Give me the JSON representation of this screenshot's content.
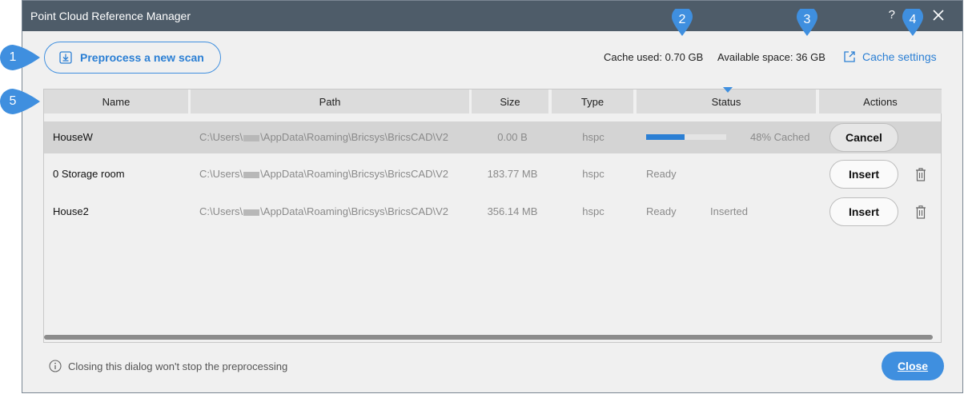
{
  "window": {
    "title": "Point Cloud Reference Manager",
    "help": "?"
  },
  "toolbar": {
    "preprocess_label": "Preprocess a new scan",
    "cache_used": "Cache used: 0.70 GB",
    "available_space": "Available space: 36 GB",
    "cache_settings_label": "Cache settings"
  },
  "table": {
    "columns": [
      "Name",
      "Path",
      "Size",
      "Type",
      "Status",
      "Actions"
    ],
    "rows": [
      {
        "name": "HouseW",
        "path_prefix": "C:\\Users\\",
        "path_suffix": "\\AppData\\Roaming\\Bricsys\\BricsCAD\\V2",
        "size": "0.00 B",
        "type": "hspc",
        "progress": 0.48,
        "progress_label": "48% Cached",
        "action": "Cancel"
      },
      {
        "name": "0 Storage room",
        "path_prefix": "C:\\Users\\",
        "path_suffix": "\\AppData\\Roaming\\Bricsys\\BricsCAD\\V2",
        "size": "183.77 MB",
        "type": "hspc",
        "status": "Ready",
        "action": "Insert"
      },
      {
        "name": "House2",
        "path_prefix": "C:\\Users\\",
        "path_suffix": "\\AppData\\Roaming\\Bricsys\\BricsCAD\\V2",
        "size": "356.14 MB",
        "type": "hspc",
        "status": "Ready",
        "status_extra": "Inserted",
        "action": "Insert"
      }
    ]
  },
  "footer": {
    "note": "Closing this dialog won't stop the preprocessing",
    "close_label": "Close"
  },
  "callouts": [
    "1",
    "2",
    "3",
    "4",
    "5"
  ],
  "colors": {
    "accent": "#3f8fdf",
    "titlebar": "#4e5c69",
    "dialog_bg": "#f0f0f0"
  }
}
